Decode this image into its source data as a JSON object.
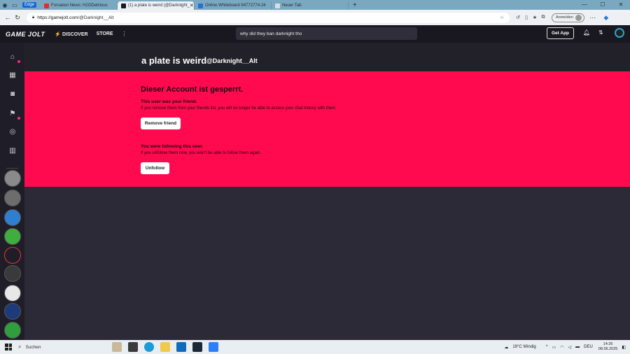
{
  "browser": {
    "badge": "Edge",
    "tabs": [
      {
        "label": "Forsaken News: H2ODelirious",
        "active": false,
        "fav_color": "#e52d27"
      },
      {
        "label": "(1) a plate is weird (@Darknight_",
        "active": true,
        "fav_color": "#1a1a1a"
      },
      {
        "label": "Online Whiteboard 94772774-24",
        "active": false,
        "fav_color": "#2a6fd6"
      },
      {
        "label": "Neuer Tab",
        "active": false,
        "fav_color": "#d8dde3"
      }
    ],
    "url_host": "https://gamejolt.com",
    "url_path": "/@Darknight__Alt",
    "signin_label": "Anmelden"
  },
  "gj_header": {
    "logo": "GAME JOLT",
    "discover": "DISCOVER",
    "store": "STORE",
    "search_value": "why did they ban darknight tho",
    "get_app": "Get App"
  },
  "profile": {
    "name": "a plate is weird",
    "username": "@Darknight__Alt"
  },
  "banned": {
    "title": "Dieser Account ist gesperrt.",
    "friend_heading": "This user was your friend.",
    "friend_text": "If you remove them from your friends list, you will no longer be able to access your chat history with them.",
    "remove_friend": "Remove friend",
    "follow_heading": "You were following this user.",
    "follow_text": "If you unfollow them now, you won't be able to follow them again.",
    "unfollow": "Unfollow"
  },
  "taskbar": {
    "search": "Suchen",
    "weather": "19°C  Windig",
    "lang": "DEU",
    "time": "14:26",
    "date": "08.06.2025"
  },
  "colors": {
    "accent_pink": "#ff0a4f",
    "bg_dark": "#2b2a36"
  }
}
